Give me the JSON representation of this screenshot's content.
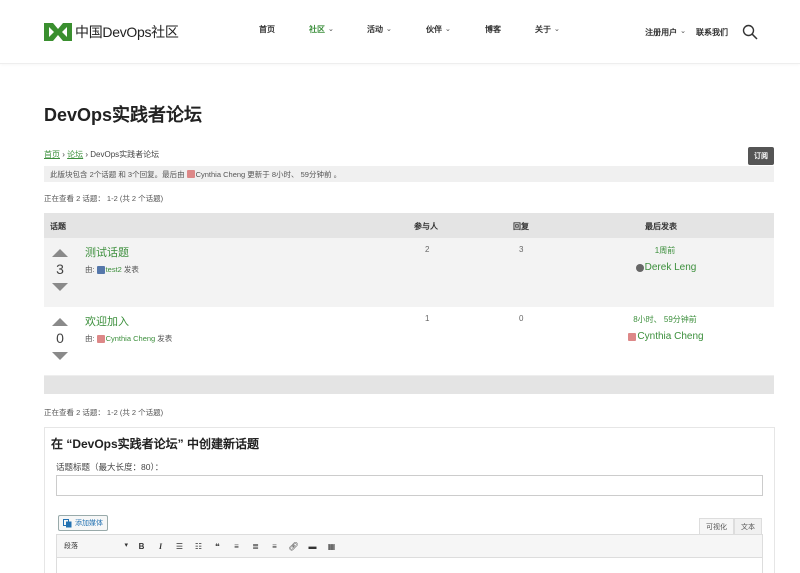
{
  "header": {
    "logo_text": "中国DevOps社区",
    "nav": [
      {
        "label": "首页",
        "dropdown": false,
        "active": false
      },
      {
        "label": "社区",
        "dropdown": true,
        "active": true
      },
      {
        "label": "活动",
        "dropdown": true,
        "active": false
      },
      {
        "label": "伙伴",
        "dropdown": true,
        "active": false
      },
      {
        "label": "博客",
        "dropdown": false,
        "active": false
      },
      {
        "label": "关于",
        "dropdown": true,
        "active": false
      }
    ],
    "register_label": "注册用户",
    "contact_label": "联系我们"
  },
  "page": {
    "title": "DevOps实践者论坛",
    "breadcrumb": {
      "home": "首页",
      "sep": "›",
      "forum": "论坛",
      "current": "DevOps实践者论坛"
    },
    "subscribe_label": "订阅",
    "forum_info_prefix": "此版块包含 2个话题 和 3个回复。最后由",
    "forum_info_user": "Cynthia Cheng",
    "forum_info_suffix": " 更新于 8小时、 59分钟前 。",
    "viewing_text": "正在查看 2 话题： 1-2 (共 2 个话题)"
  },
  "table": {
    "headers": {
      "topic": "话题",
      "voices": "参与人",
      "replies": "回复",
      "last_post": "最后发表"
    },
    "by_prefix": "由:",
    "by_suffix": "发表",
    "rows": [
      {
        "score": "3",
        "title": "测试话题",
        "author": "test2",
        "voices": "2",
        "replies": "3",
        "last_time": "1周前",
        "last_user": "Derek Leng"
      },
      {
        "score": "0",
        "title": "欢迎加入",
        "author": "Cynthia Cheng",
        "voices": "1",
        "replies": "0",
        "last_time": "8小时、 59分钟前",
        "last_user": "Cynthia Cheng"
      }
    ]
  },
  "new_topic": {
    "heading": "在 “DevOps实践者论坛” 中创建新话题",
    "title_label": "话题标题（最大长度：80）：",
    "title_value": "",
    "add_media_label": "添加媒体",
    "tab_visual": "可视化",
    "tab_text": "文本",
    "format_value": "段落",
    "toolbar_bold": "B",
    "toolbar_italic": "I"
  },
  "colors": {
    "accent": "#3c8f3c",
    "header_bg": "#e4e4e4",
    "row_alt": "#f3f3f3"
  }
}
